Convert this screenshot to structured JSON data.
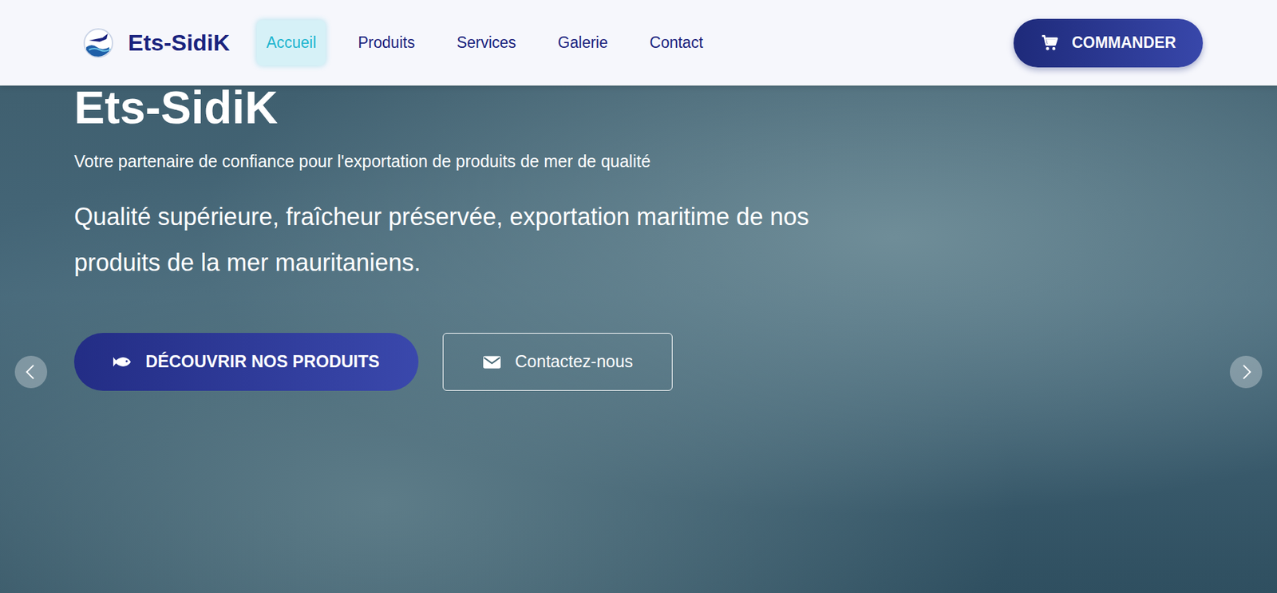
{
  "brand": {
    "name": "Ets-SidiK"
  },
  "nav": {
    "items": [
      {
        "label": "Accueil",
        "selected": true
      },
      {
        "label": "Produits",
        "selected": false
      },
      {
        "label": "Services",
        "selected": false
      },
      {
        "label": "Galerie",
        "selected": false
      },
      {
        "label": "Contact",
        "selected": false
      }
    ],
    "order_button": "COMMANDER"
  },
  "hero": {
    "title": "Ets-SidiK",
    "subtitle": "Votre partenaire de confiance pour l'exportation de produits de mer de qualité",
    "tagline": "Qualité supérieure, fraîcheur préservée, exportation maritime de nos produits de la mer mauritaniens.",
    "buttons": [
      {
        "label": "DÉCOUVRIR NOS PRODUITS",
        "kind": "primary"
      },
      {
        "label": "Contactez-nous",
        "kind": "outline"
      }
    ]
  }
}
